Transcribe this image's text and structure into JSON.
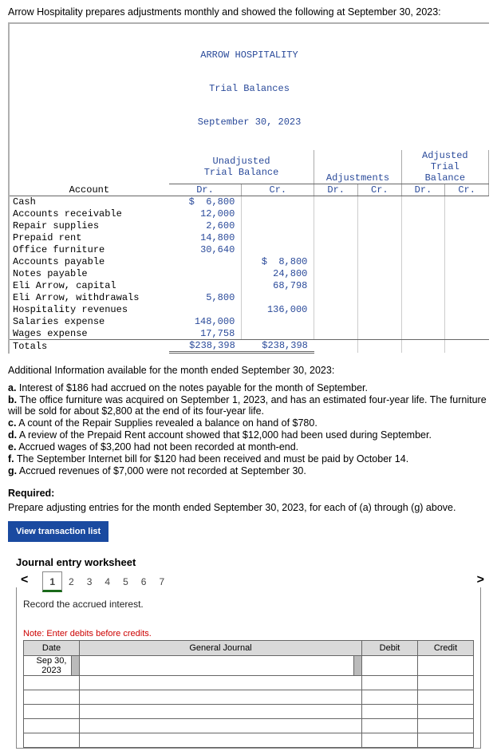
{
  "intro": "Arrow Hospitality prepares adjustments monthly and showed the following at September 30, 2023:",
  "tb": {
    "title1": "ARROW HOSPITALITY",
    "title2": "Trial Balances",
    "title3": "September 30, 2023",
    "grp1": "Unadjusted\nTrial Balance",
    "grp2": "Adjustments",
    "grp3": "Adjusted\nTrial\nBalance",
    "acct_h": "Account",
    "dr": "Dr.",
    "cr": "Cr.",
    "rows": [
      {
        "a": "Cash",
        "udr": "$  6,800",
        "ucr": ""
      },
      {
        "a": "Accounts receivable",
        "udr": "12,000",
        "ucr": ""
      },
      {
        "a": "Repair supplies",
        "udr": "2,600",
        "ucr": ""
      },
      {
        "a": "Prepaid rent",
        "udr": "14,800",
        "ucr": ""
      },
      {
        "a": "Office furniture",
        "udr": "30,640",
        "ucr": ""
      },
      {
        "a": "Accounts payable",
        "udr": "",
        "ucr": "$  8,800"
      },
      {
        "a": "Notes payable",
        "udr": "",
        "ucr": "24,800"
      },
      {
        "a": "Eli Arrow, capital",
        "udr": "",
        "ucr": "68,798"
      },
      {
        "a": "Eli Arrow, withdrawals",
        "udr": "5,800",
        "ucr": ""
      },
      {
        "a": "Hospitality revenues",
        "udr": "",
        "ucr": "136,000"
      },
      {
        "a": "Salaries expense",
        "udr": "148,000",
        "ucr": ""
      },
      {
        "a": "Wages expense",
        "udr": "17,758",
        "ucr": ""
      }
    ],
    "tot_label": "Totals",
    "tot_dr": "$238,398",
    "tot_cr": "$238,398"
  },
  "addl_h": "Additional Information available for the month ended September 30, 2023:",
  "addl": [
    {
      "k": "a.",
      "t": "Interest of $186 had accrued on the notes payable for the month of September."
    },
    {
      "k": "b.",
      "t": "The office furniture was acquired on September 1, 2023, and has an estimated four-year life. The furniture will be sold for about $2,800 at the end of its four-year life."
    },
    {
      "k": "c.",
      "t": "A count of the Repair Supplies revealed a balance on hand of $780."
    },
    {
      "k": "d.",
      "t": "A review of the Prepaid Rent account showed that $12,000 had been used during September."
    },
    {
      "k": "e.",
      "t": "Accrued wages of $3,200 had not been recorded at month-end."
    },
    {
      "k": "f.",
      "t": "The September Internet bill for $120 had been received and must be paid by October 14."
    },
    {
      "k": "g.",
      "t": "Accrued revenues of $7,000 were not recorded at September 30."
    }
  ],
  "req_h": "Required:",
  "req_t": "Prepare adjusting entries for the month ended September 30, 2023, for each of (a) through (g) above.",
  "vtl": "View transaction list",
  "jew": "Journal entry worksheet",
  "tabs": [
    "1",
    "2",
    "3",
    "4",
    "5",
    "6",
    "7"
  ],
  "instr": "Record the accrued interest.",
  "note": "Note: Enter debits before credits.",
  "je": {
    "h_date": "Date",
    "h_gj": "General Journal",
    "h_debit": "Debit",
    "h_credit": "Credit",
    "date_val": "Sep 30, 2023"
  }
}
